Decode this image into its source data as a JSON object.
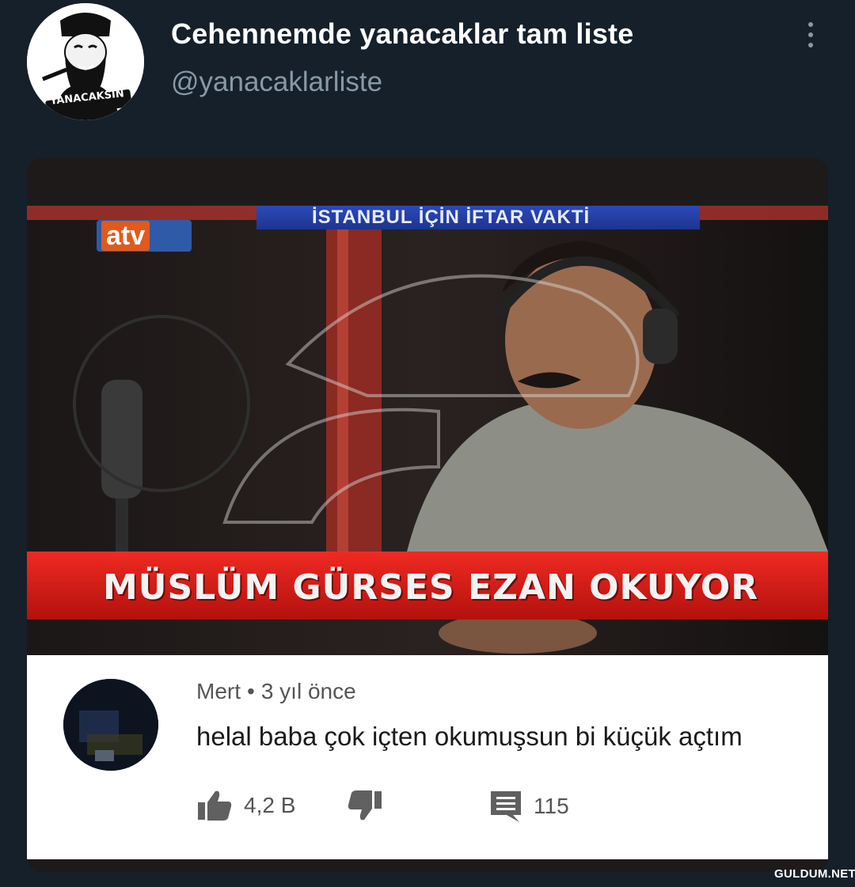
{
  "tweet": {
    "display_name": "Cehennemde yanacaklar tam liste",
    "handle": "@yanacaklarliste",
    "avatar_caption": "YANACAKSIN",
    "more_icon": "more-vertical-icon"
  },
  "video": {
    "channel_logo": "atv",
    "top_ticker": "İSTANBUL İÇİN İFTAR VAKTİ",
    "lower_third": "MÜSLÜM GÜRSES EZAN OKUYOR",
    "progress": 0.07
  },
  "comment": {
    "author": "Mert",
    "separator": "•",
    "time": "3 yıl önce",
    "text": "helal baba çok içten okumuşsun bi küçük açtım",
    "likes": "4,2 B",
    "replies": "115",
    "icons": [
      "thumbs-up-icon",
      "thumbs-down-icon",
      "comment-icon"
    ]
  },
  "watermark": "GULDUM.NET",
  "colors": {
    "background": "#15202b",
    "handle": "#8899a6",
    "lower_third_red": "#e0201b",
    "ticker_blue": "#2c49b8"
  }
}
